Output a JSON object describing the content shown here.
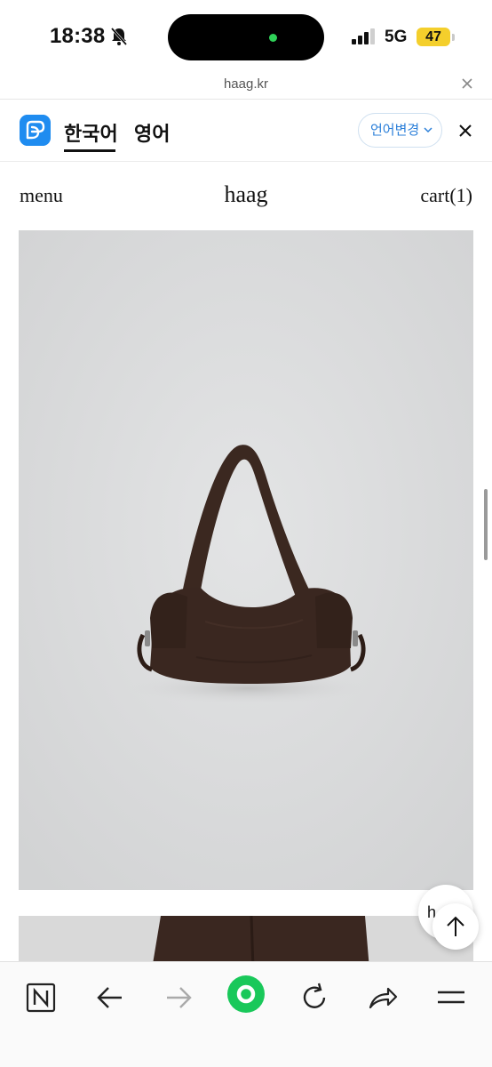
{
  "status_bar": {
    "time": "18:38",
    "network": "5G",
    "battery": "47"
  },
  "url_bar": {
    "url": "haag.kr"
  },
  "translate_bar": {
    "tabs": [
      {
        "label": "한국어",
        "active": true
      },
      {
        "label": "영어",
        "active": false
      }
    ],
    "change_language_label": "언어변경"
  },
  "site_nav": {
    "menu_label": "menu",
    "logo": "haag",
    "cart_label": "cart(1)"
  },
  "chat_button": {
    "label": "h"
  },
  "colors": {
    "accent": "#1f8cf0",
    "green": "#19c85a",
    "product_bg": "#d8d9da",
    "bag": "#3a2720"
  },
  "icons": {
    "status": [
      "bell-muted-icon",
      "signal-icon"
    ],
    "toolbar": [
      "naver-icon",
      "back-arrow-icon",
      "forward-arrow-icon",
      "green-dot-icon",
      "reload-icon",
      "share-icon",
      "menu-icon"
    ]
  }
}
